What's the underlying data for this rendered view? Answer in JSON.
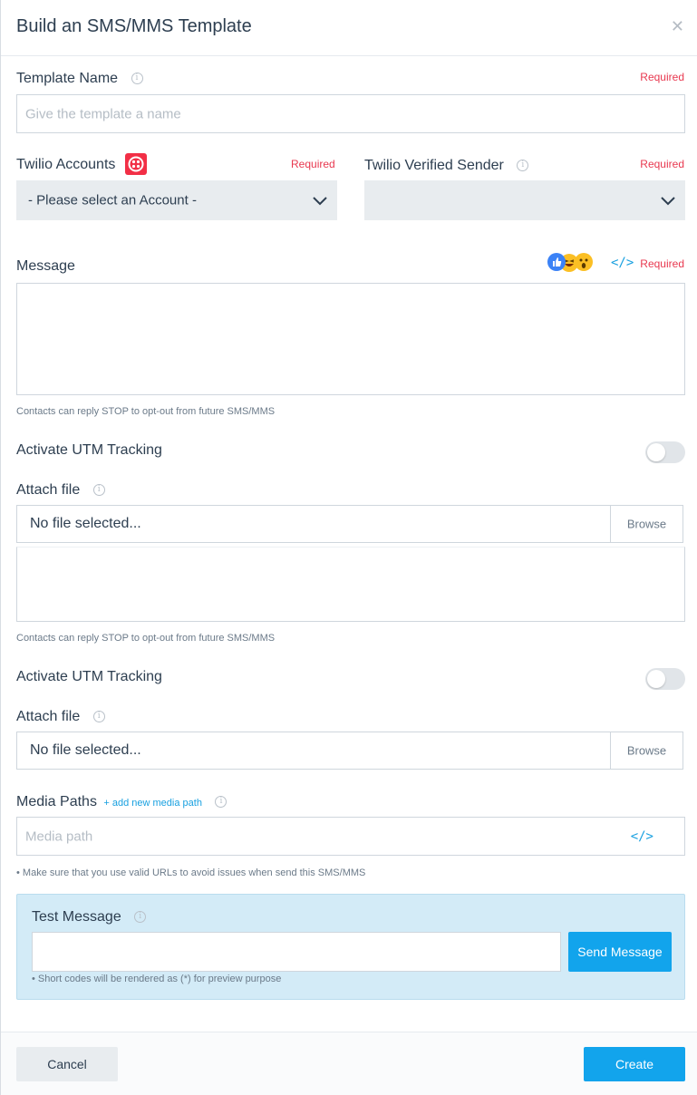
{
  "modal": {
    "title": "Build an SMS/MMS Template",
    "close_icon": "close-icon"
  },
  "template_name": {
    "label": "Template Name",
    "required": "Required",
    "placeholder": "Give the template a name",
    "value": ""
  },
  "twilio_accounts": {
    "label": "Twilio Accounts",
    "required": "Required",
    "selected": "- Please select an Account -",
    "logo_color": "#f22f46"
  },
  "verified_sender": {
    "label": "Twilio Verified Sender",
    "required": "Required",
    "selected": ""
  },
  "message": {
    "label": "Message",
    "required": "Required",
    "value": "",
    "hint": "Contacts can reply STOP to opt-out from future SMS/MMS",
    "icons": [
      "like-emoji-icon",
      "laugh-emoji-icon",
      "wow-emoji-icon",
      "code-icon"
    ]
  },
  "utm_1": {
    "label": "Activate UTM Tracking",
    "enabled": false
  },
  "attach_1": {
    "label": "Attach file",
    "file": "No file selected...",
    "browse": "Browse"
  },
  "message_2": {
    "value": "",
    "hint": "Contacts can reply STOP to opt-out from future SMS/MMS"
  },
  "utm_2": {
    "label": "Activate UTM Tracking",
    "enabled": false
  },
  "attach_2": {
    "label": "Attach file",
    "file": "No file selected...",
    "browse": "Browse"
  },
  "media_paths": {
    "label": "Media Paths",
    "add_link": "+ add new media path",
    "placeholder": "Media path",
    "hint": "• Make sure that you use valid URLs to avoid issues when send this SMS/MMS"
  },
  "test_message": {
    "label": "Test Message",
    "value": "",
    "send_button": "Send Message",
    "hint": "• Short codes will be rendered as (*) for preview purpose"
  },
  "footer": {
    "cancel": "Cancel",
    "create": "Create"
  },
  "colors": {
    "accent": "#12a4ec",
    "required": "#e8384f",
    "test_bg": "#d3ebf7"
  }
}
